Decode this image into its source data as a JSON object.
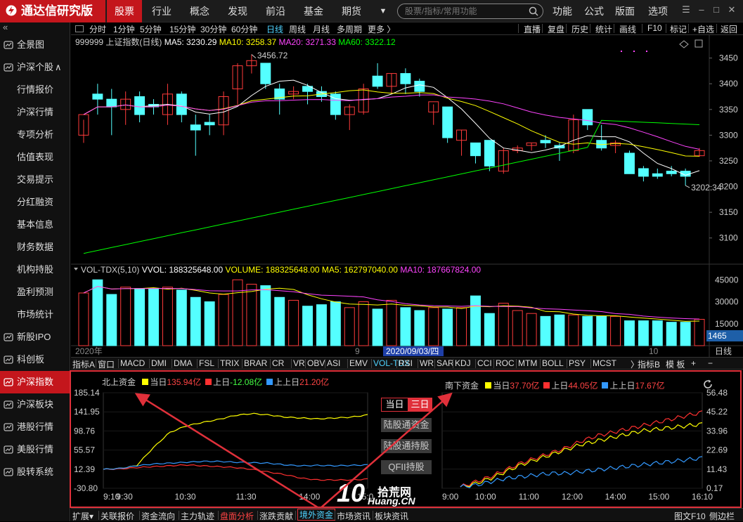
{
  "app": {
    "name": "通达信研究版",
    "menu_tabs": [
      "股票",
      "行业",
      "概念",
      "发现",
      "前沿",
      "基金",
      "期货"
    ],
    "active_tab": 0,
    "search_placeholder": "股票/指标/常用功能",
    "right_links": [
      "功能",
      "公式",
      "版面",
      "选项"
    ]
  },
  "sidebar": {
    "collapse_glyph": "«",
    "items": [
      {
        "label": "全景图",
        "kind": "top",
        "icon": "panorama-icon"
      },
      {
        "label": "沪深个股",
        "kind": "top",
        "icon": "stock-icon",
        "suffix": "∧"
      },
      {
        "label": "行情报价",
        "kind": "sub"
      },
      {
        "label": "沪深行情",
        "kind": "sub"
      },
      {
        "label": "专项分析",
        "kind": "sub"
      },
      {
        "label": "估值表现",
        "kind": "sub"
      },
      {
        "label": "交易提示",
        "kind": "sub"
      },
      {
        "label": "分红融资",
        "kind": "sub"
      },
      {
        "label": "基本信息",
        "kind": "sub"
      },
      {
        "label": "财务数据",
        "kind": "sub"
      },
      {
        "label": "机构持股",
        "kind": "sub"
      },
      {
        "label": "盈利预测",
        "kind": "sub"
      },
      {
        "label": "市场统计",
        "kind": "sub"
      },
      {
        "label": "新股IPO",
        "kind": "top",
        "icon": "ipo-icon"
      },
      {
        "label": "科创板",
        "kind": "top",
        "icon": "star-board-icon"
      },
      {
        "label": "沪深指数",
        "kind": "top",
        "icon": "index-icon",
        "active": true
      },
      {
        "label": "沪深板块",
        "kind": "top",
        "icon": "sector-icon"
      },
      {
        "label": "港股行情",
        "kind": "top",
        "icon": "hk-icon"
      },
      {
        "label": "美股行情",
        "kind": "top",
        "icon": "us-icon"
      },
      {
        "label": "股转系统",
        "kind": "top",
        "icon": "neeq-icon"
      }
    ]
  },
  "period_bar": {
    "left": [
      "分时",
      "1分钟",
      "5分钟",
      "15分钟",
      "30分钟",
      "60分钟",
      "日线",
      "周线",
      "月线",
      "多周期",
      "更多 〉"
    ],
    "active": "日线",
    "right": [
      "直播",
      "复盘",
      "历史",
      "统计",
      "画线",
      "F10",
      "标记",
      "+自选",
      "返回"
    ]
  },
  "kline": {
    "title": "999999 上证指数(日线)",
    "ma5": "MA5: 3230.29",
    "ma10": "MA10: 3258.37",
    "ma20": "MA20: 3271.33",
    "ma60": "MA60: 3322.12",
    "high_label": "3456.72",
    "low_label": "3202.34",
    "y_ticks": [
      "3450",
      "3400",
      "3350",
      "3300",
      "3250",
      "3200",
      "3150",
      "3100"
    ],
    "candles": [
      {
        "o": 3300,
        "h": 3330,
        "l": 3285,
        "c": 3340
      },
      {
        "o": 3380,
        "h": 3400,
        "l": 3340,
        "c": 3370
      },
      {
        "o": 3370,
        "h": 3390,
        "l": 3300,
        "c": 3355
      },
      {
        "o": 3350,
        "h": 3385,
        "l": 3320,
        "c": 3370
      },
      {
        "o": 3375,
        "h": 3385,
        "l": 3325,
        "c": 3340
      },
      {
        "o": 3360,
        "h": 3370,
        "l": 3340,
        "c": 3355
      },
      {
        "o": 3340,
        "h": 3400,
        "l": 3320,
        "c": 3380
      },
      {
        "o": 3380,
        "h": 3385,
        "l": 3325,
        "c": 3340
      },
      {
        "o": 3320,
        "h": 3340,
        "l": 3260,
        "c": 3310
      },
      {
        "o": 3325,
        "h": 3340,
        "l": 3300,
        "c": 3320
      },
      {
        "o": 3320,
        "h": 3385,
        "l": 3300,
        "c": 3375
      },
      {
        "o": 3390,
        "h": 3440,
        "l": 3360,
        "c": 3435
      },
      {
        "o": 3435,
        "h": 3457,
        "l": 3420,
        "c": 3445
      },
      {
        "o": 3440,
        "h": 3440,
        "l": 3390,
        "c": 3400
      },
      {
        "o": 3390,
        "h": 3400,
        "l": 3340,
        "c": 3370
      },
      {
        "o": 3380,
        "h": 3395,
        "l": 3370,
        "c": 3385
      },
      {
        "o": 3395,
        "h": 3400,
        "l": 3360,
        "c": 3385
      },
      {
        "o": 3385,
        "h": 3395,
        "l": 3365,
        "c": 3375
      },
      {
        "o": 3380,
        "h": 3385,
        "l": 3330,
        "c": 3340
      },
      {
        "o": 3340,
        "h": 3360,
        "l": 3310,
        "c": 3355
      },
      {
        "o": 3345,
        "h": 3400,
        "l": 3340,
        "c": 3390
      },
      {
        "o": 3415,
        "h": 3440,
        "l": 3390,
        "c": 3395
      },
      {
        "o": 3395,
        "h": 3420,
        "l": 3380,
        "c": 3420
      },
      {
        "o": 3420,
        "h": 3430,
        "l": 3380,
        "c": 3400
      },
      {
        "o": 3405,
        "h": 3410,
        "l": 3375,
        "c": 3385
      },
      {
        "o": 3345,
        "h": 3360,
        "l": 3320,
        "c": 3365
      },
      {
        "o": 3355,
        "h": 3355,
        "l": 3285,
        "c": 3295
      },
      {
        "o": 3290,
        "h": 3310,
        "l": 3260,
        "c": 3310
      },
      {
        "o": 3285,
        "h": 3285,
        "l": 3245,
        "c": 3260
      },
      {
        "o": 3290,
        "h": 3290,
        "l": 3230,
        "c": 3240
      },
      {
        "o": 3230,
        "h": 3275,
        "l": 3225,
        "c": 3270
      },
      {
        "o": 3270,
        "h": 3280,
        "l": 3265,
        "c": 3275
      },
      {
        "o": 3280,
        "h": 3285,
        "l": 3270,
        "c": 3285
      },
      {
        "o": 3290,
        "h": 3300,
        "l": 3275,
        "c": 3285
      },
      {
        "o": 3280,
        "h": 3285,
        "l": 3250,
        "c": 3275
      },
      {
        "o": 3270,
        "h": 3340,
        "l": 3265,
        "c": 3330
      },
      {
        "o": 3350,
        "h": 3350,
        "l": 3310,
        "c": 3320
      },
      {
        "o": 3290,
        "h": 3320,
        "l": 3270,
        "c": 3275
      },
      {
        "o": 3280,
        "h": 3290,
        "l": 3265,
        "c": 3285
      },
      {
        "o": 3265,
        "h": 3270,
        "l": 3225,
        "c": 3225
      },
      {
        "o": 3235,
        "h": 3240,
        "l": 3210,
        "c": 3220
      },
      {
        "o": 3225,
        "h": 3235,
        "l": 3215,
        "c": 3220
      },
      {
        "o": 3230,
        "h": 3240,
        "l": 3220,
        "c": 3225
      },
      {
        "o": 3230,
        "h": 3235,
        "l": 3202,
        "c": 3220
      },
      {
        "o": 3260,
        "h": 3275,
        "l": 3258,
        "c": 3270
      }
    ],
    "colors": {
      "up": "#ff3b3b",
      "down": "#54ffff",
      "ma5": "#ffffff",
      "ma10": "#ffff00",
      "ma20": "#ff44ff",
      "ma60": "#00ff00"
    }
  },
  "volume": {
    "title": "VOL-TDX(5,10)",
    "vvol": "VVOL: 188325648.00",
    "volume": "VOLUME: 188325648.00",
    "ma5": "MA5: 162797040.00",
    "ma10": "MA10: 187667824.00",
    "y_ticks": [
      "45000",
      "30000",
      "15000"
    ],
    "current_box": "1465",
    "unit": "日线",
    "date_left": "2020年",
    "date_mid": "9",
    "date_cursor": "2020/09/03/四",
    "date_right": "10",
    "bars": [
      360,
      450,
      350,
      400,
      390,
      390,
      400,
      380,
      330,
      300,
      350,
      450,
      420,
      410,
      330,
      310,
      270,
      280,
      300,
      260,
      300,
      250,
      310,
      260,
      240,
      260,
      250,
      260,
      340,
      220,
      290,
      240,
      220,
      200,
      210,
      210,
      200,
      200,
      200,
      170,
      170,
      170,
      160,
      160,
      180
    ]
  },
  "indicator_bar": {
    "items": [
      "指标A",
      "窗口",
      "MACD",
      "DMI",
      "DMA",
      "FSL",
      "TRIX",
      "BRAR",
      "CR",
      "VR",
      "OBV",
      "ASI",
      "EMV",
      "VOL-TDX",
      "RSI",
      "WR",
      "SAR",
      "KDJ",
      "CCI",
      "ROC",
      "MTM",
      "BOLL",
      "PSY",
      "MCST",
      "〉",
      "指标B",
      "模 板",
      "+",
      "−"
    ],
    "active": "VOL-TDX"
  },
  "north_panel": {
    "title": "北上资金",
    "legend": [
      {
        "label": "当日",
        "value": "135.94亿",
        "color": "#ffff00",
        "value_color": "#ff4444"
      },
      {
        "label": "上日",
        "value": "-12.08亿",
        "color": "#ff3030",
        "value_color": "#44ff44"
      },
      {
        "label": "上上日",
        "value": "21.20亿",
        "color": "#3399ff",
        "value_color": "#ff4444"
      }
    ],
    "y_ticks": [
      "185.14",
      "141.95",
      "98.76",
      "55.57",
      "12.39",
      "-30.80"
    ],
    "x_ticks": [
      "9:10",
      "9:30",
      "10:30",
      "11:30",
      "14:00",
      "15:00"
    ]
  },
  "middle_controls": {
    "toggle": [
      "当日",
      "三日"
    ],
    "buttons": [
      "陆股通资金",
      "陆股通持股",
      "QFII持股"
    ]
  },
  "south_panel": {
    "title": "南下资金",
    "legend": [
      {
        "label": "当日",
        "value": "37.70亿",
        "color": "#ffff00",
        "value_color": "#ff4444"
      },
      {
        "label": "上日",
        "value": "44.05亿",
        "color": "#ff3030",
        "value_color": "#ff4444"
      },
      {
        "label": "上上日",
        "value": "17.67亿",
        "color": "#3399ff",
        "value_color": "#ff4444"
      }
    ],
    "y_ticks": [
      "56.48",
      "45.22",
      "33.96",
      "22.69",
      "11.43",
      "0.17"
    ],
    "x_ticks": [
      "9:00",
      "10:00",
      "11:00",
      "12:00",
      "14:00",
      "15:00",
      "16:10"
    ]
  },
  "bottom_bar": {
    "items": [
      "扩展▾",
      "关联报价",
      "资金流向",
      "主力轨迹",
      "盘面分析",
      "涨跌贡献",
      "境外资金",
      "市场资讯",
      "板块资讯"
    ],
    "red_item": "盘面分析",
    "boxed_item": "境外资金",
    "right": "图文F10",
    "right2": "侧边栏"
  },
  "watermark": {
    "big": "10",
    "site": "拾荒网",
    "domain": "Huang.CN"
  }
}
